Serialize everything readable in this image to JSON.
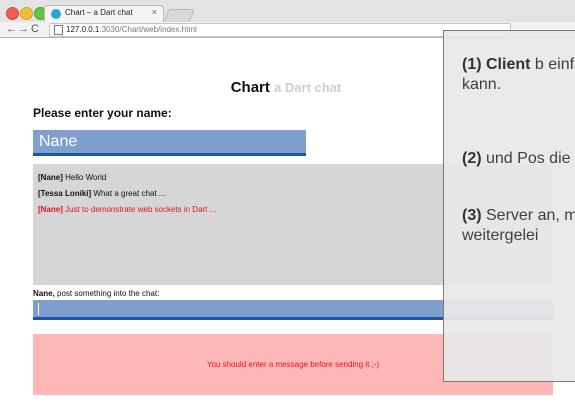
{
  "browser": {
    "tab_title": "Chart – a Dart chat",
    "tab_close": "×",
    "back": "←",
    "forward": "→",
    "reload": "C",
    "url_host": "127.0.0.1",
    "url_rest": ":3030/Chart/web/index.html"
  },
  "page": {
    "title": "Chart",
    "subtitle": "a Dart chat",
    "name_prompt": "Please enter your name:",
    "name_value": "Nane",
    "messages": [
      {
        "author": "[Nane]",
        "text": " Hello World",
        "color": "#111111"
      },
      {
        "author": "[Tessa Loniki]",
        "text": " What a great chat ...",
        "color": "#111111"
      },
      {
        "author": "[Nane]",
        "text": " Just to demonstrate web sockets in Dart ...",
        "color": "#e0151d"
      }
    ],
    "post_label_name": "Nane,",
    "post_label_text": " post something into the chat:",
    "post_value": "",
    "error_text": "You should enter a message before sending it ;-)"
  },
  "overlay": {
    "p1_bold": "(1) Client",
    "p1_text": " b einfachen I Nutzer eine kann.",
    "p2_bold": "(2)",
    "p2_text": " und Pos die an eine",
    "p3_bold": "(3)",
    "p3_text": " Server an, mit den empfanger weitergelei"
  },
  "colors": {
    "accent_blue": "#7fa0cc",
    "accent_blue_border": "#1d56a8",
    "error_bg": "#ffb7b7",
    "error_text": "#e0151d",
    "chat_bg": "#d6d6d6"
  }
}
